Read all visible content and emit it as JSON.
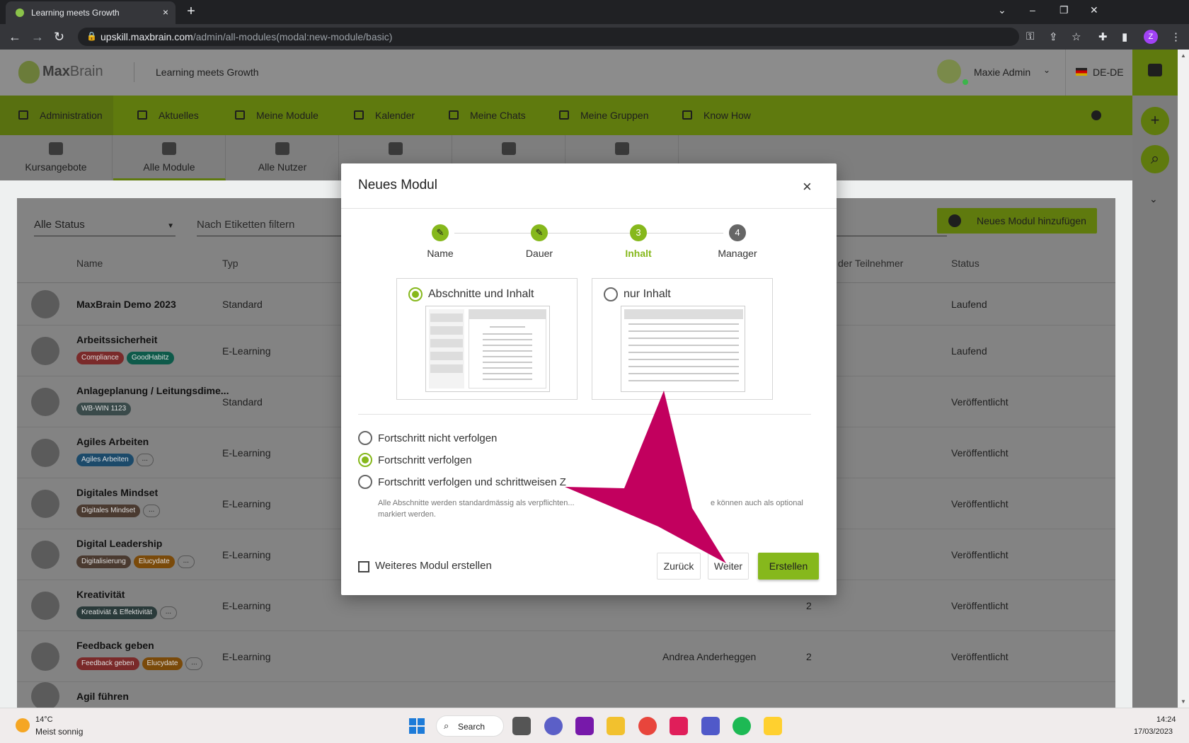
{
  "browser": {
    "tab_title": "Learning meets Growth",
    "tab_close": "×",
    "new_tab": "+",
    "url_host": "upskill.maxbrain.com",
    "url_path": "/admin/all-modules(modal:new-module/basic)",
    "profile_initial": "Z",
    "window_controls": [
      "⌄",
      "–",
      "❐",
      "✕"
    ]
  },
  "app": {
    "logo_bold": "Max",
    "logo_regular": "Brain",
    "tagline": "Learning meets Growth",
    "user_name": "Maxie Admin",
    "language": "DE-DE",
    "accent_color": "#86b81c"
  },
  "main_nav": [
    {
      "label": "Administration",
      "icon": "admin-icon"
    },
    {
      "label": "Aktuelles",
      "icon": "news-icon"
    },
    {
      "label": "Meine Module",
      "icon": "graduation-cap-icon"
    },
    {
      "label": "Kalender",
      "icon": "calendar-icon"
    },
    {
      "label": "Meine Chats",
      "icon": "chat-icon"
    },
    {
      "label": "Meine Gruppen",
      "icon": "groups-icon"
    },
    {
      "label": "Know How",
      "icon": "book-icon"
    }
  ],
  "sub_tabs": [
    {
      "label": "Kursangebote",
      "icon": "courses-icon"
    },
    {
      "label": "Alle Module",
      "icon": "institution-icon"
    },
    {
      "label": "Alle Nutzer",
      "icon": "users-icon"
    },
    {
      "label": "",
      "icon": "groups-icon"
    },
    {
      "label": "",
      "icon": "report-icon"
    },
    {
      "label": "",
      "icon": "settings-icon"
    }
  ],
  "filters": {
    "status": "Alle Status",
    "tags_placeholder": "Nach Etiketten filtern",
    "add_module": "Neues Modul hinzufügen"
  },
  "table": {
    "columns": {
      "name": "Name",
      "type": "Typ",
      "participants": "der Teilnehmer",
      "status": "Status"
    },
    "rows": [
      {
        "name": "MaxBrain Demo 2023",
        "type": "Standard",
        "tags": [],
        "more": "",
        "manager": "",
        "count": "",
        "status": "Laufend"
      },
      {
        "name": "Arbeitssicherheit",
        "type": "E-Learning",
        "tags": [
          {
            "label": "Compliance",
            "color": "#7a2a2a"
          },
          {
            "label": "GoodHabitz",
            "color": "#0e5a4a"
          }
        ],
        "more": "",
        "manager": "",
        "count": "",
        "status": "Laufend"
      },
      {
        "name": "Anlageplanung / Leitungsdime...",
        "type": "Standard",
        "tags": [
          {
            "label": "WB-WIN 1123",
            "color": "#3a4a4a"
          }
        ],
        "more": "",
        "manager": "",
        "count": "",
        "status": "Veröffentlicht"
      },
      {
        "name": "Agiles Arbeiten",
        "type": "E-Learning",
        "tags": [
          {
            "label": "Agiles Arbeiten",
            "color": "#1c4a6a"
          }
        ],
        "more": "...",
        "manager": "",
        "count": "",
        "status": "Veröffentlicht"
      },
      {
        "name": "Digitales Mindset",
        "type": "E-Learning",
        "tags": [
          {
            "label": "Digitales Mindset",
            "color": "#4a3a30"
          }
        ],
        "more": "...",
        "manager": "",
        "count": "",
        "status": "Veröffentlicht"
      },
      {
        "name": "Digital Leadership",
        "type": "E-Learning",
        "tags": [
          {
            "label": "Digitalisierung",
            "color": "#4a3a30"
          },
          {
            "label": "Elucydate",
            "color": "#7a4a0a"
          }
        ],
        "more": "...",
        "manager": "",
        "count": "",
        "status": "Veröffentlicht"
      },
      {
        "name": "Kreativität",
        "type": "E-Learning",
        "tags": [
          {
            "label": "Kreativiät & Effektivität",
            "color": "#2a3a3a"
          }
        ],
        "more": "...",
        "manager": "",
        "count": "2",
        "status": "Veröffentlicht"
      },
      {
        "name": "Feedback geben",
        "type": "E-Learning",
        "tags": [
          {
            "label": "Feedback geben",
            "color": "#7a2a2a"
          },
          {
            "label": "Elucydate",
            "color": "#7a4a0a"
          }
        ],
        "more": "...",
        "manager": "Andrea Anderheggen",
        "count": "2",
        "status": "Veröffentlicht"
      },
      {
        "name": "Agil führen",
        "type": "",
        "tags": [],
        "more": "",
        "manager": "",
        "count": "",
        "status": ""
      }
    ]
  },
  "modal": {
    "title": "Neues Modul",
    "close": "×",
    "steps": [
      {
        "label": "Name",
        "mark": "✎",
        "state": "done"
      },
      {
        "label": "Dauer",
        "mark": "✎",
        "state": "done"
      },
      {
        "label": "Inhalt",
        "mark": "3",
        "state": "active"
      },
      {
        "label": "Manager",
        "mark": "4",
        "state": "pending"
      }
    ],
    "layouts": [
      {
        "label": "Abschnitte und Inhalt",
        "selected": true
      },
      {
        "label": "nur Inhalt",
        "selected": false
      }
    ],
    "progress_options": [
      {
        "label": "Fortschritt nicht verfolgen",
        "selected": false
      },
      {
        "label": "Fortschritt verfolgen",
        "selected": true
      },
      {
        "label": "Fortschritt verfolgen und schrittweisen Z",
        "selected": false
      }
    ],
    "hint_left": "Alle Abschnitte werden standardmässig als verpflichten...",
    "hint_right": "e können auch als optional",
    "hint_line2": "markiert werden.",
    "checkbox_label": "Weiteres Modul erstellen",
    "checkbox_checked": false,
    "btn_back": "Zurück",
    "btn_next": "Weiter",
    "btn_create": "Erstellen"
  },
  "annotation": {
    "color": "#c2005e"
  },
  "taskbar": {
    "temp": "14°C",
    "weather": "Meist sonnig",
    "search": "Search",
    "time": "14:24",
    "date": "17/03/2023",
    "apps": [
      "file-explorer-icon",
      "chat-icon",
      "onenote-icon",
      "folder-icon",
      "chrome-icon",
      "slack-icon",
      "teams-icon",
      "spotify-icon",
      "miro-icon"
    ]
  }
}
